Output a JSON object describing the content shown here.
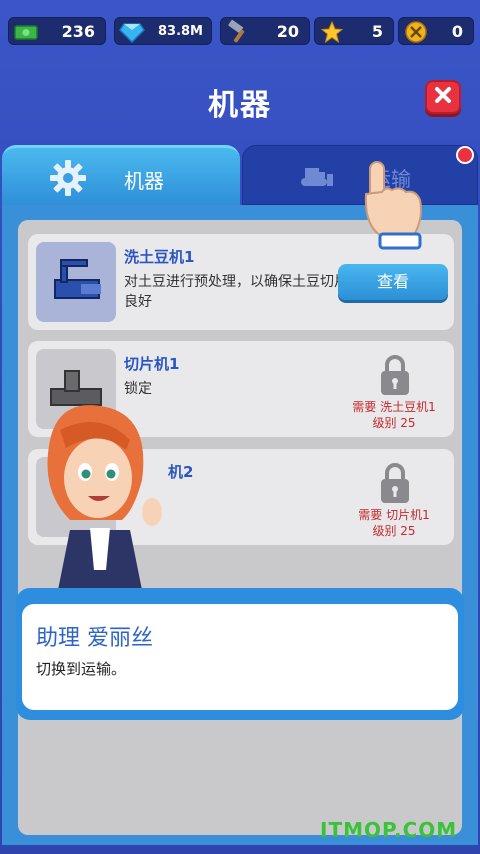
{
  "resources": [
    {
      "icon": "cash-icon",
      "value": "236"
    },
    {
      "icon": "diamond-icon",
      "value": "83.8M"
    },
    {
      "icon": "hammer-icon",
      "value": "20"
    },
    {
      "icon": "star-icon",
      "value": "5"
    },
    {
      "icon": "wrench-badge-icon",
      "value": "0"
    }
  ],
  "title": "机器",
  "tabs": [
    {
      "label": "机器",
      "icon": "gear-icon",
      "active": true
    },
    {
      "label": "运输",
      "icon": "bulldozer-icon",
      "active": false,
      "notification": true
    }
  ],
  "machines": [
    {
      "name": "洗土豆机1",
      "desc": "对土豆进行预处理，以确保土豆切片良好",
      "button": "查看",
      "locked": false
    },
    {
      "name": "切片机1",
      "desc": "锁定",
      "locked": true,
      "req_line1": "需要 洗土豆机1",
      "req_line2": "级别 25"
    },
    {
      "name": "机2",
      "locked": true,
      "req_line1": "需要 切片机1",
      "req_line2": "级别 25"
    }
  ],
  "dialog": {
    "speaker": "助理 爱丽丝",
    "message": "切换到运输。"
  },
  "watermark": "ITMOP.COM",
  "colors": {
    "background": "#3349b8",
    "accent": "#2f8fd8",
    "close": "#e8323f",
    "locked_text": "#c42a2a"
  }
}
